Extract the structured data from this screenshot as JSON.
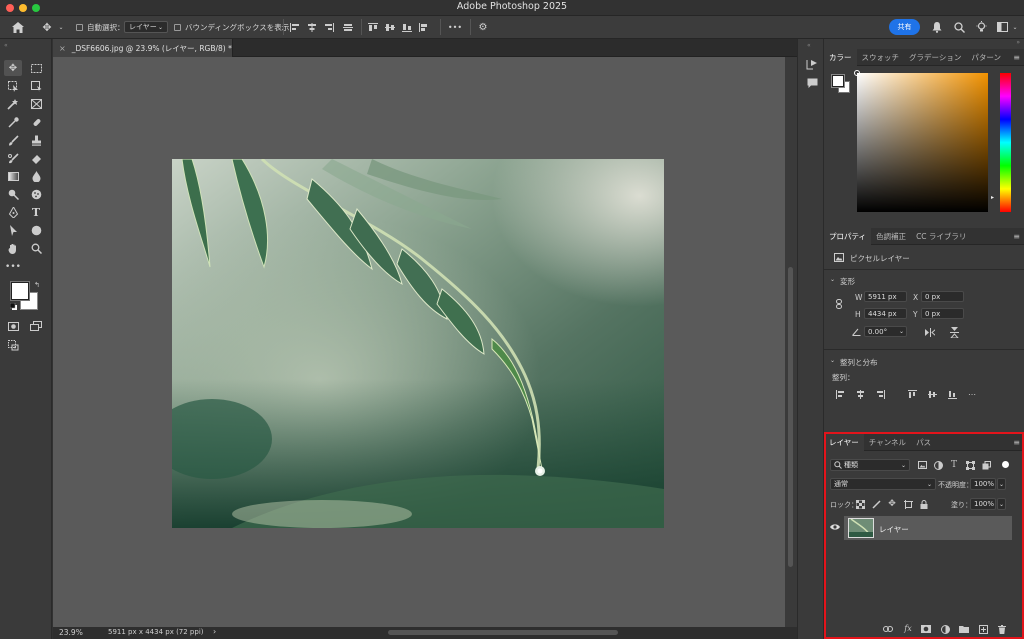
{
  "app": {
    "title": "Adobe Photoshop 2025"
  },
  "options": {
    "auto_select_label": "自動選択：",
    "auto_select_value": "レイヤー",
    "bbox_label": "バウンディングボックスを表示",
    "more": "•••",
    "share": "共有"
  },
  "document": {
    "tab_label": "_DSF6606.jpg @ 23.9% (レイヤー, RGB/8) *",
    "zoom": "23.9%",
    "info": "5911 px x 4434 px (72 ppi)"
  },
  "color_panel": {
    "tabs": [
      "カラー",
      "スウォッチ",
      "グラデーション",
      "パターン"
    ]
  },
  "properties": {
    "tabs": [
      "プロパティ",
      "色調補正",
      "CC ライブラリ"
    ],
    "kind": "ピクセルレイヤー",
    "transform_title": "変形",
    "w_label": "W",
    "w_value": "5911 px",
    "h_label": "H",
    "h_value": "4434 px",
    "x_label": "X",
    "x_value": "0 px",
    "y_label": "Y",
    "y_value": "0 px",
    "angle_value": "0.00°",
    "align_title": "整列と分布",
    "align_label": "整列："
  },
  "layers_panel": {
    "tabs": [
      "レイヤー",
      "チャンネル",
      "パス"
    ],
    "filter_label": "種類",
    "blend_mode": "通常",
    "opacity_label": "不透明度：",
    "opacity_value": "100%",
    "lock_label": "ロック：",
    "fill_label": "塗り：",
    "fill_value": "100%",
    "layer_name": "レイヤー"
  },
  "colors": {
    "accent": "#1f73e8",
    "highlight_box": "#e3141b",
    "fg_swatch": "#ffffff",
    "bg_swatch": "#ffffff"
  }
}
